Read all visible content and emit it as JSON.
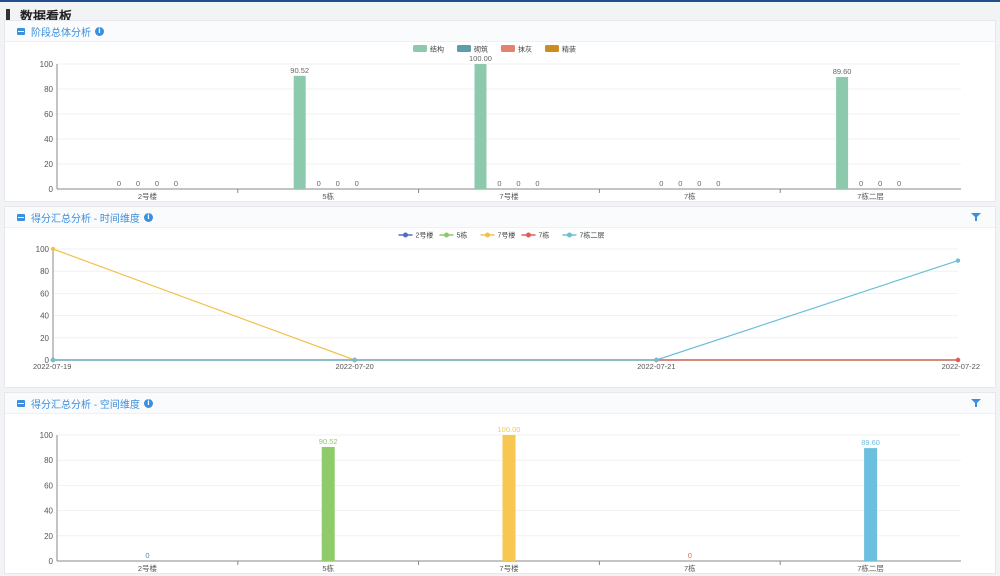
{
  "page": {
    "title": "数据看板"
  },
  "panels": {
    "p1": {
      "title": "阶段总体分析",
      "info": "i"
    },
    "p2": {
      "title": "得分汇总分析 - 时间维度",
      "info": "i"
    },
    "p3": {
      "title": "得分汇总分析 - 空间维度",
      "info": "i"
    }
  },
  "chart_data": [
    {
      "type": "bar",
      "categories": [
        "2号楼",
        "5栋",
        "7号楼",
        "7栋",
        "7栋二层"
      ],
      "series": [
        {
          "name": "结构",
          "color": "#8dcaad",
          "values": [
            0,
            90.52,
            100.0,
            0,
            89.6
          ]
        },
        {
          "name": "砌筑",
          "color": "#5e9ea8",
          "values": [
            0,
            0,
            0,
            0,
            0
          ]
        },
        {
          "name": "抹灰",
          "color": "#e3826d",
          "values": [
            0,
            0,
            0,
            0,
            0
          ]
        },
        {
          "name": "精装",
          "color": "#c98d22",
          "values": [
            0,
            0,
            0,
            0,
            0
          ]
        }
      ],
      "value_labels": [
        [
          "0",
          "90.52",
          "100.00",
          "0",
          "89.60"
        ],
        [
          "0",
          "0",
          "0",
          "0",
          "0"
        ],
        [
          "0",
          "0",
          "0",
          "0",
          "0"
        ],
        [
          "0",
          "0",
          "0",
          "0",
          "0"
        ]
      ],
      "ylim": [
        0,
        100
      ],
      "yticks": [
        0,
        20,
        40,
        60,
        80,
        100
      ],
      "legend": "top-center",
      "grid": true
    },
    {
      "type": "line",
      "x": [
        "2022-07-19",
        "2022-07-20",
        "2022-07-21",
        "2022-07-22"
      ],
      "series": [
        {
          "name": "2号楼",
          "color": "#4a6fc9",
          "values": [
            0,
            0,
            0,
            0
          ]
        },
        {
          "name": "5栋",
          "color": "#8bc96a",
          "values": [
            0,
            0,
            0,
            0
          ]
        },
        {
          "name": "7号楼",
          "color": "#f0c24a",
          "values": [
            100,
            0,
            0,
            0
          ]
        },
        {
          "name": "7栋",
          "color": "#e05c5c",
          "values": [
            0,
            0,
            0,
            0
          ]
        },
        {
          "name": "7栋二层",
          "color": "#6bbfd6",
          "values": [
            0,
            0,
            0,
            89.6
          ]
        }
      ],
      "ylim": [
        0,
        100
      ],
      "yticks": [
        0,
        20,
        40,
        60,
        80,
        100
      ],
      "legend": "top-center",
      "grid": true
    },
    {
      "type": "bar",
      "categories": [
        "2号楼",
        "5栋",
        "7号楼",
        "7栋",
        "7栋二层"
      ],
      "values": [
        0,
        90.52,
        100.0,
        0,
        89.6
      ],
      "value_labels": [
        "0",
        "90.52",
        "100.00",
        "0",
        "89.60"
      ],
      "colors": [
        "#5b7fd1",
        "#8fcb6b",
        "#f7c752",
        "#e06a5c",
        "#6cbfde"
      ],
      "ylim": [
        0,
        100
      ],
      "yticks": [
        0,
        20,
        40,
        60,
        80,
        100
      ],
      "grid": true
    }
  ]
}
